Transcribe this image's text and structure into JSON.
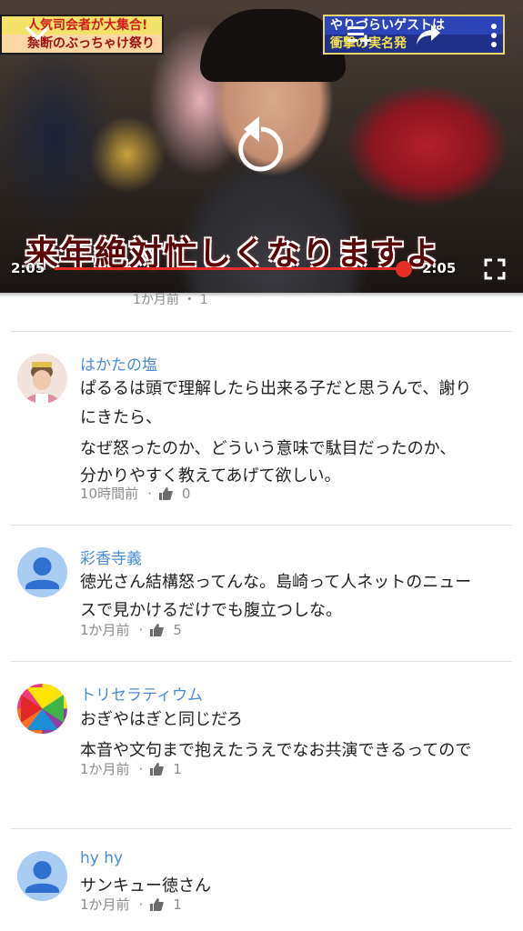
{
  "player": {
    "caption_top_left_line1": "人気司会者が大集合!",
    "caption_top_left_line2": "禁断のぶっちゃけ祭り",
    "caption_top_right_line1": "やりづらいゲストは",
    "caption_top_right_line2": "衝撃の実名発",
    "subtitle": "来年絶対忙しくなりますよ",
    "current_time": "2:05",
    "duration": "2:05",
    "progress": 1.0,
    "accent_color": "#e52d27"
  },
  "clipped_comment": {
    "meta": "1か月前 ・ 1"
  },
  "comments": [
    {
      "author": "はかたの塩",
      "lines": [
        "ぱるるは頭で理解したら出来る子だと思うんで、謝り",
        "にきたら、",
        "なぜ怒ったのか、どういう意味で駄目だったのか、",
        "分かりやすく教えてあげて欲しい。"
      ],
      "time": "10時間前",
      "likes": "0",
      "avatar": "photo"
    },
    {
      "author": "彩香寺義",
      "lines": [
        "徳光さん結構怒ってんな。島崎って人ネットのニュー",
        "スで見かけるだけでも腹立つしな。"
      ],
      "time": "1か月前",
      "likes": "5",
      "avatar": "default-person"
    },
    {
      "author": "トリセラティウム",
      "lines": [
        "おぎやはぎと同じだろ",
        "本音や文句まで抱えたうえでなお共演できるってので"
      ],
      "time": "1か月前",
      "likes": "1",
      "avatar": "pinwheel"
    },
    {
      "author": "hy hy",
      "lines": [
        "サンキュー徳さん"
      ],
      "time": "1か月前",
      "likes": "1",
      "avatar": "default-person"
    }
  ],
  "colors": {
    "author_link": "#4a8bd4",
    "meta_text": "#8c8c8c",
    "default_avatar": "#a9ccf2"
  }
}
